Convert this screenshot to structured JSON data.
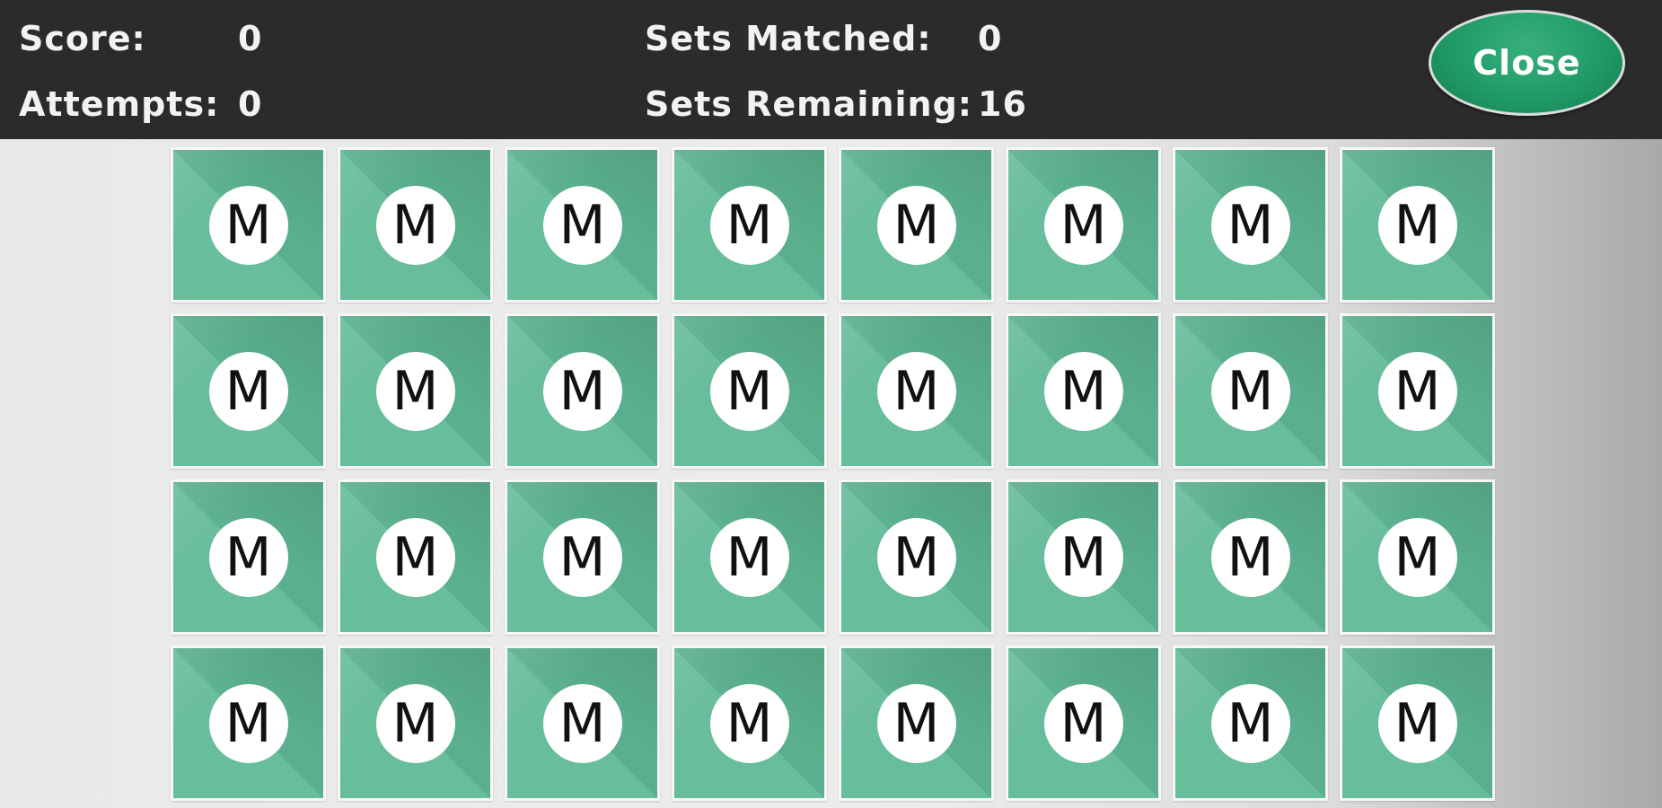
{
  "header": {
    "score_label": "Score:",
    "score_value": "0",
    "attempts_label": "Attempts:",
    "attempts_value": "0",
    "sets_matched_label": "Sets Matched:",
    "sets_matched_value": "0",
    "sets_remaining_label": "Sets Remaining:",
    "sets_remaining_value": "16",
    "close_label": "Close"
  },
  "board": {
    "rows": 4,
    "columns": 8,
    "card_face_letter": "M",
    "card_color": "#5fb995"
  },
  "colors": {
    "topbar": "#2b2b2b",
    "close_button": "#1f9a66"
  }
}
